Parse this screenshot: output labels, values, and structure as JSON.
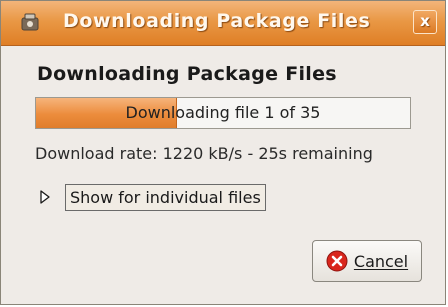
{
  "window": {
    "title": "Downloading Package Files",
    "close_label": "x"
  },
  "main": {
    "heading": "Downloading Package Files",
    "progress": {
      "text": "Downloading file 1 of 35",
      "fraction": 0.375
    },
    "rate_text": "Download rate: 1220 kB/s - 25s remaining",
    "expander_label": "Show for individual files",
    "cancel_label": "Cancel"
  },
  "icons": {
    "title": "package-manager-icon",
    "expander": "triangle-right-icon",
    "cancel": "cancel-icon"
  },
  "colors": {
    "accent": "#df7e25",
    "progress_fill": "#ec8c3c",
    "cancel_icon": "#d9261c"
  }
}
